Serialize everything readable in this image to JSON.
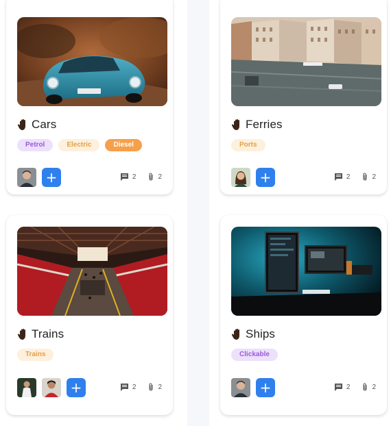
{
  "cards": [
    {
      "title": "Cars",
      "image": "vintage-blue-car-photo",
      "tags": [
        "Petrol",
        "Electric",
        "Diesel"
      ],
      "comments": "2",
      "attachments": "2"
    },
    {
      "title": "Ferries",
      "image": "venice-canal-photo",
      "tags": [
        "Ports"
      ],
      "comments": "2",
      "attachments": "2"
    },
    {
      "title": "Trains",
      "image": "train-station-photo",
      "tags": [
        "Trains"
      ],
      "comments": "2",
      "attachments": "2"
    },
    {
      "title": "Ships",
      "image": "computer-desk-setup-photo",
      "tags": [
        "Clickable"
      ],
      "comments": "2",
      "attachments": "2"
    }
  ],
  "add_label": "+",
  "icons": {
    "title": "hand-icon",
    "comment": "comment-icon",
    "attachment": "paperclip-icon",
    "add": "plus-icon"
  },
  "colors": {
    "accent": "#2f80ed",
    "tag_purple_bg": "#ede0fb",
    "tag_purple_fg": "#9a5bd8",
    "tag_cream_bg": "#fdf0dc",
    "tag_cream_fg": "#e2a048",
    "tag_orange_bg": "#f6a04a"
  }
}
